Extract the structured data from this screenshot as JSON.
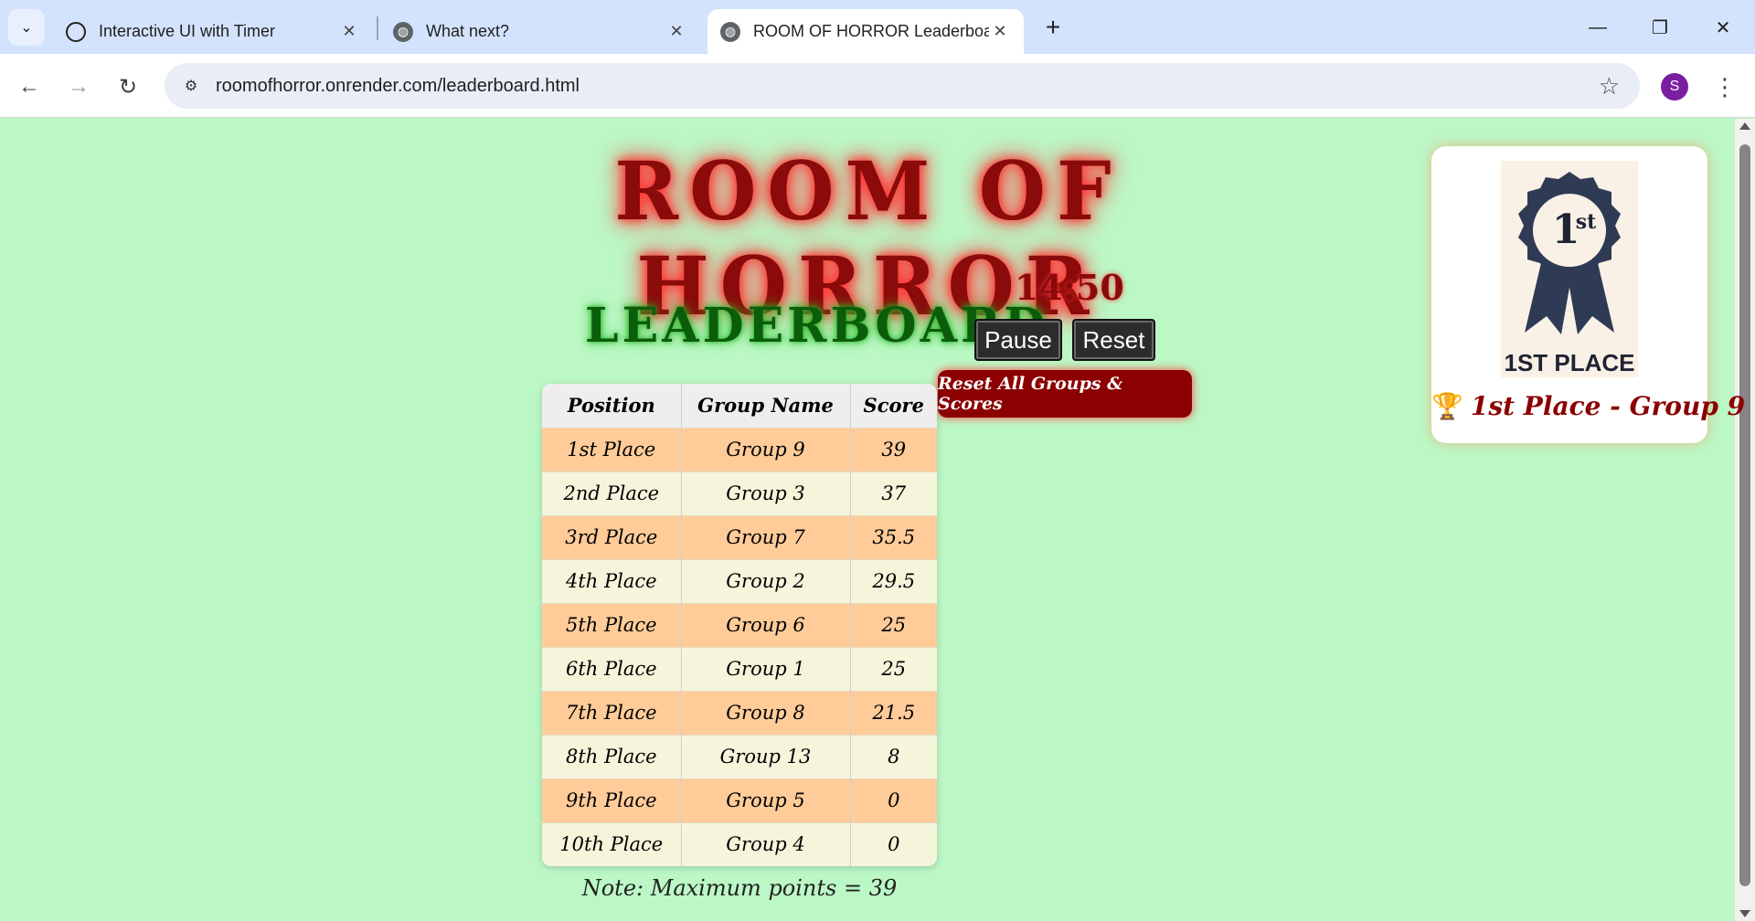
{
  "browser": {
    "tabs": [
      {
        "title": "Interactive UI with Timer",
        "icon": "chatgpt-icon",
        "active": false
      },
      {
        "title": "What next?",
        "icon": "globe-icon",
        "active": false
      },
      {
        "title": "ROOM OF HORROR Leaderboard",
        "icon": "globe-icon",
        "active": true
      }
    ],
    "url": "roomofhorror.onrender.com/leaderboard.html",
    "profile_initial": "S"
  },
  "page": {
    "title": "ROOM OF HORROR",
    "subtitle": "LEADERBOARD",
    "timer": "14:50",
    "pause_label": "Pause",
    "reset_label": "Reset",
    "reset_all_label": "Reset All Groups & Scores",
    "table": {
      "headers": [
        "Position",
        "Group Name",
        "Score"
      ],
      "rows": [
        [
          "1st Place",
          "Group 9",
          "39"
        ],
        [
          "2nd Place",
          "Group 3",
          "37"
        ],
        [
          "3rd Place",
          "Group 7",
          "35.5"
        ],
        [
          "4th Place",
          "Group 2",
          "29.5"
        ],
        [
          "5th Place",
          "Group 6",
          "25"
        ],
        [
          "6th Place",
          "Group 1",
          "25"
        ],
        [
          "7th Place",
          "Group 8",
          "21.5"
        ],
        [
          "8th Place",
          "Group 13",
          "8"
        ],
        [
          "9th Place",
          "Group 5",
          "0"
        ],
        [
          "10th Place",
          "Group 4",
          "0"
        ]
      ]
    },
    "note": "Note: Maximum points = 39",
    "winner": {
      "medal_number": "1",
      "medal_suffix": "st",
      "medal_caption": "1ST PLACE",
      "trophy": "🏆",
      "text": "1st Place - Group 9"
    }
  },
  "colors": {
    "page_bg": "#bcf8c6",
    "title_red": "#8b0a0a",
    "title_green": "#0b5d0b",
    "row_odd": "#ffcc99",
    "row_even": "#f5f5dc",
    "button_dark": "#2c2c2c",
    "button_red": "#8b0000"
  }
}
